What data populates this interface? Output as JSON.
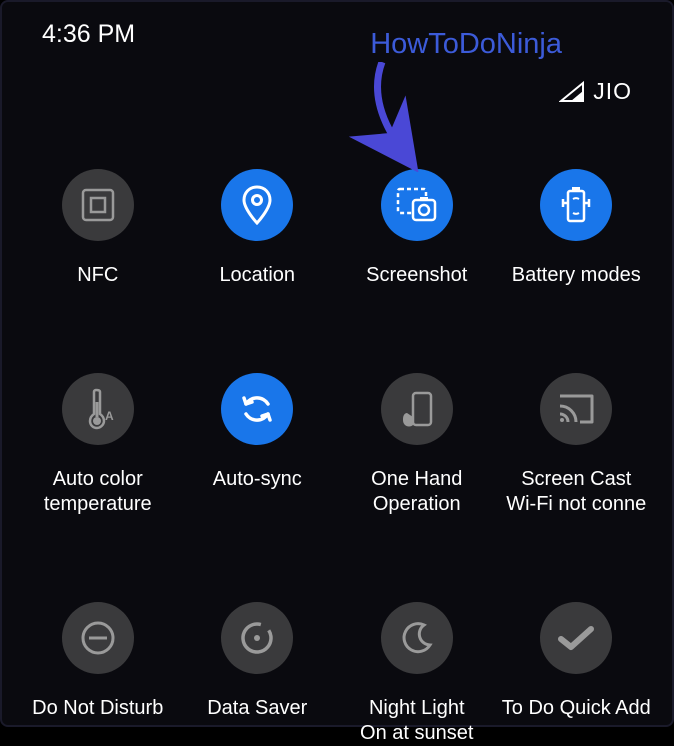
{
  "status": {
    "time": "4:36 PM",
    "carrier": "JIO"
  },
  "annotation": {
    "text": "HowToDoNinja"
  },
  "tiles": [
    {
      "label": "NFC",
      "sublabel": "",
      "active": false
    },
    {
      "label": "Location",
      "sublabel": "",
      "active": true
    },
    {
      "label": "Screenshot",
      "sublabel": "",
      "active": true
    },
    {
      "label": "Battery modes",
      "sublabel": "",
      "active": true
    },
    {
      "label": "Auto color temperature",
      "sublabel": "",
      "active": false
    },
    {
      "label": "Auto-sync",
      "sublabel": "",
      "active": true
    },
    {
      "label": "One Hand Operation",
      "sublabel": "",
      "active": false
    },
    {
      "label": "Screen Cast",
      "sublabel": "Wi-Fi not conne",
      "active": false
    },
    {
      "label": "Do Not Disturb",
      "sublabel": "",
      "active": false
    },
    {
      "label": "Data Saver",
      "sublabel": "",
      "active": false
    },
    {
      "label": "Night Light",
      "sublabel": "On at sunset",
      "active": false
    },
    {
      "label": "To Do Quick Add",
      "sublabel": "",
      "active": false
    }
  ]
}
